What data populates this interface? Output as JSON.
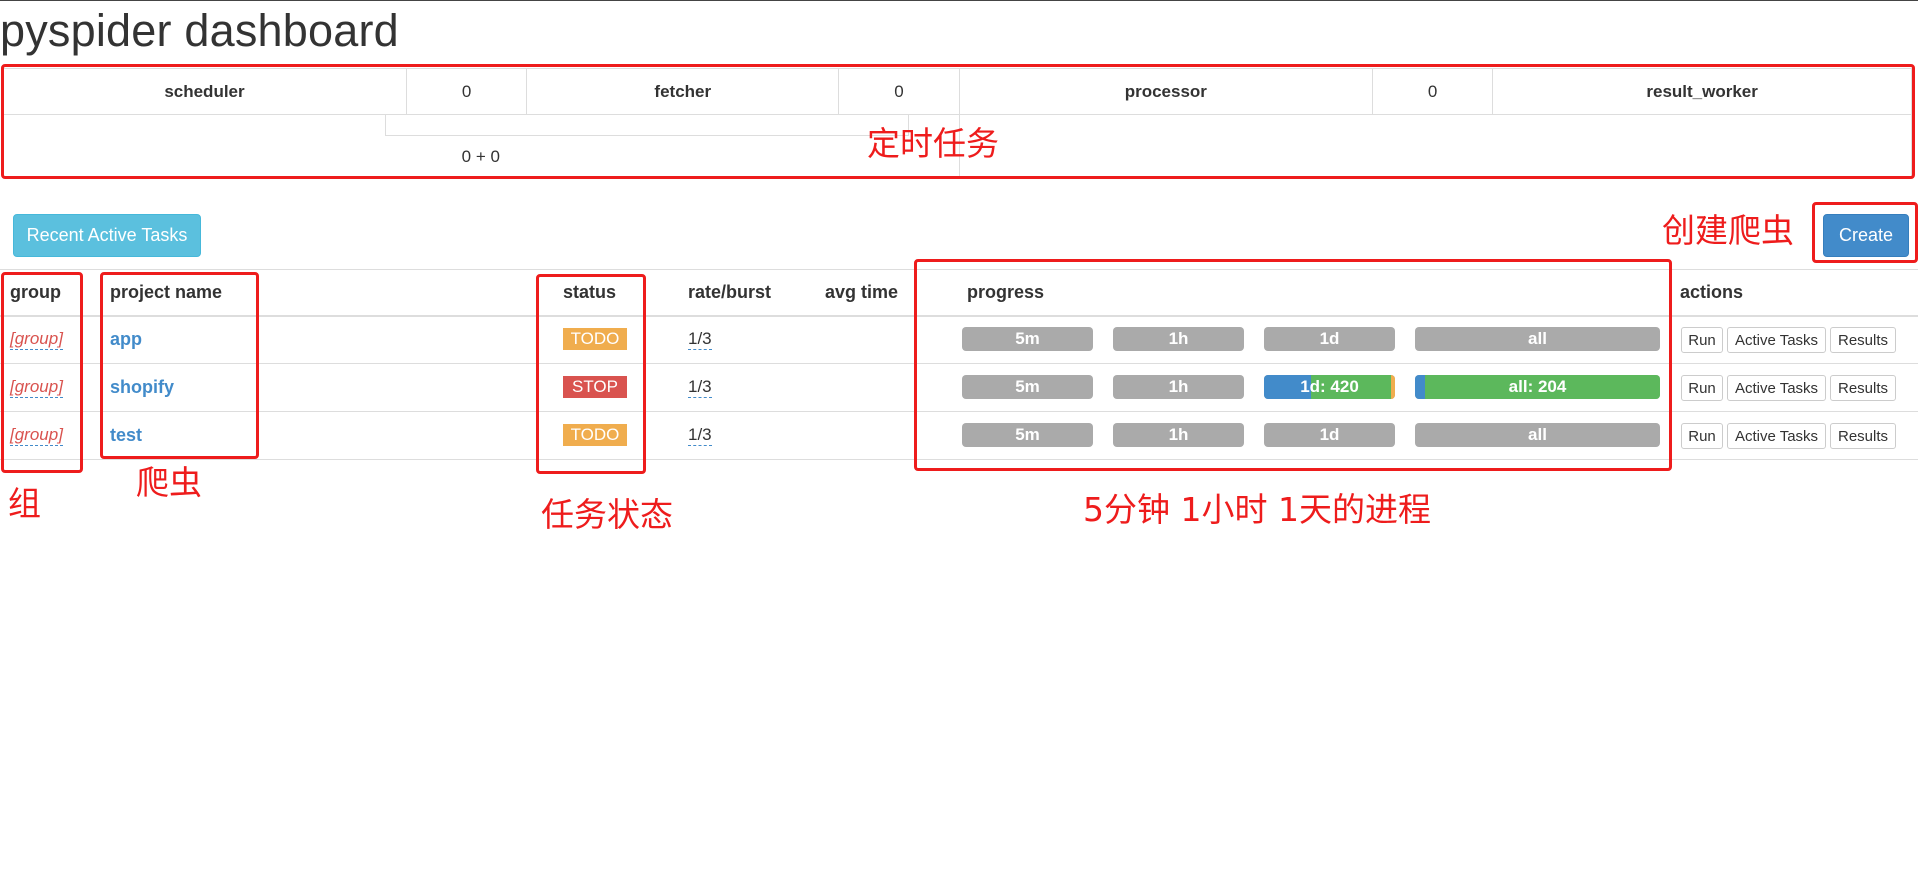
{
  "page": {
    "title": "pyspider dashboard"
  },
  "stats": {
    "scheduler_label": "scheduler",
    "scheduler_value": "0",
    "fetcher_label": "fetcher",
    "fetcher_value": "0",
    "processor_label": "processor",
    "processor_value": "0",
    "result_worker_label": "result_worker",
    "fetcher_queue": "0 + 0"
  },
  "toolbar": {
    "recent_label": "Recent Active Tasks",
    "create_label": "Create"
  },
  "columns": {
    "group": "group",
    "project_name": "project name",
    "status": "status",
    "rate_burst": "rate/burst",
    "avg_time": "avg time",
    "progress": "progress",
    "actions": "actions"
  },
  "projects": [
    {
      "group": "[group]",
      "name": "app",
      "status": "TODO",
      "status_color": "#f0ad4e",
      "rate": "1/3",
      "progress": {
        "5m": "5m",
        "1h": "1h",
        "1d": "1d",
        "all": "all"
      },
      "actions": {
        "run": "Run",
        "active": "Active Tasks",
        "results": "Results"
      }
    },
    {
      "group": "[group]",
      "name": "shopify",
      "status": "STOP",
      "status_color": "#d9534f",
      "rate": "1/3",
      "progress": {
        "5m": "5m",
        "1h": "1h",
        "1d": "1d: 420",
        "all": "all: 204"
      },
      "actions": {
        "run": "Run",
        "active": "Active Tasks",
        "results": "Results"
      }
    },
    {
      "group": "[group]",
      "name": "test",
      "status": "TODO",
      "status_color": "#f0ad4e",
      "rate": "1/3",
      "progress": {
        "5m": "5m",
        "1h": "1h",
        "1d": "1d",
        "all": "all"
      },
      "actions": {
        "run": "Run",
        "active": "Active Tasks",
        "results": "Results"
      }
    }
  ],
  "annotations": {
    "scheduled_tasks": "定时任务",
    "create_crawler": "创建爬虫",
    "group": "组",
    "crawler": "爬虫",
    "task_status": "任务状态",
    "progress_note": "5分钟 1小时 1天的进程"
  },
  "colors": {
    "annotation_red": "#ee1c1c",
    "info_button": "#5bc0de",
    "primary_button": "#428bca",
    "progress_pending": "#428bca",
    "progress_success": "#5cb85c",
    "progress_retry": "#f0ad4e",
    "progress_empty": "#aaaaaa",
    "link": "#428bca",
    "group_link": "#d9534f"
  }
}
